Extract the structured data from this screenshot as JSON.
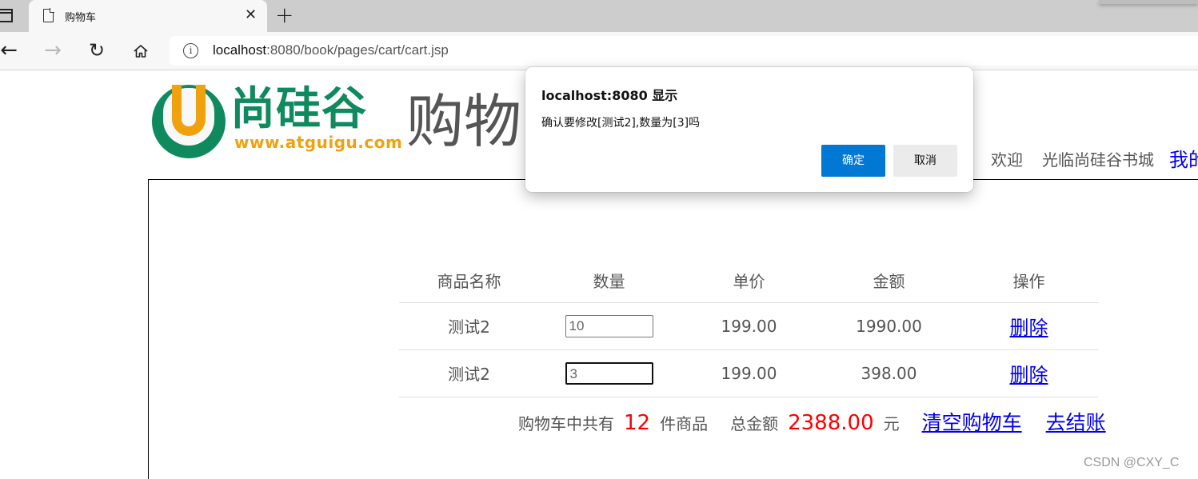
{
  "browser": {
    "tab_title": "购物车",
    "url_host": "localhost",
    "url_rest": ":8080/book/pages/cart/cart.jsp"
  },
  "header": {
    "logo_text": "尚硅谷",
    "logo_url": "www.atguigu.com",
    "page_word": "购物",
    "welcome": "欢迎",
    "mall": "光临尚硅谷书城",
    "my_link": "我的"
  },
  "cart": {
    "columns": [
      "商品名称",
      "数量",
      "单价",
      "金额",
      "操作"
    ],
    "rows": [
      {
        "name": "测试2",
        "quantity": "10",
        "price": "199.00",
        "amount": "1990.00",
        "action": "删除"
      },
      {
        "name": "测试2",
        "quantity": "3",
        "price": "199.00",
        "amount": "398.00",
        "action": "删除"
      }
    ]
  },
  "summary": {
    "count_label": "购物车中共有",
    "count": "12",
    "count_unit": "件商品",
    "amount_label": "总金额",
    "amount": "2388.00",
    "currency": "元",
    "clear_label": "清空购物车",
    "checkout_label": "去结账"
  },
  "dialog": {
    "title": "localhost:8080 显示",
    "message": "确认要修改[测试2],数量为[3]吗",
    "ok_label": "确定",
    "cancel_label": "取消"
  },
  "watermark": "CSDN @CXY_C"
}
